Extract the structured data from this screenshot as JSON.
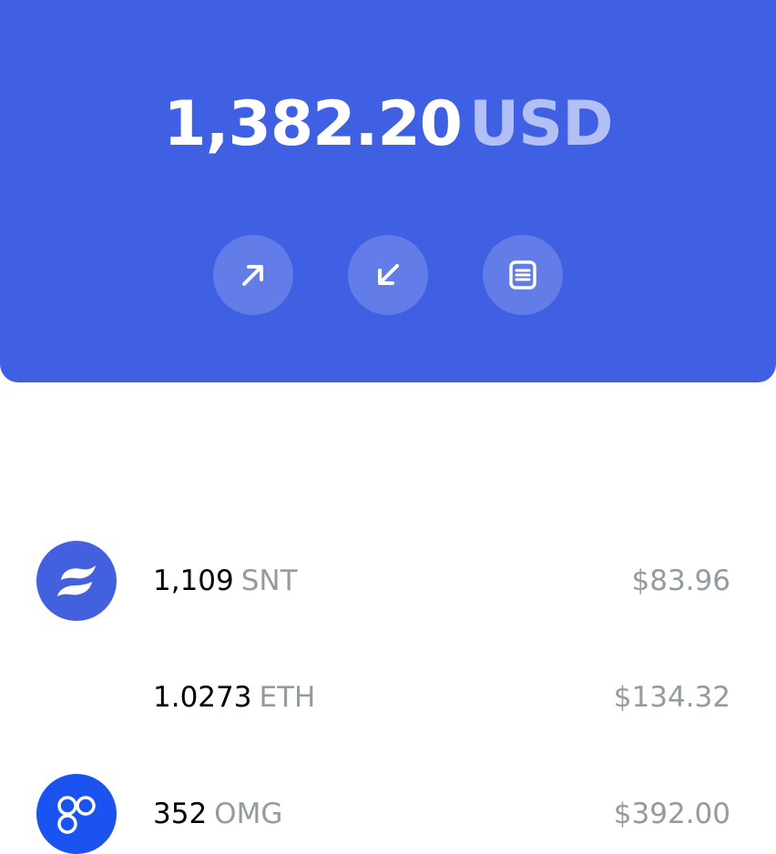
{
  "header": {
    "balance_amount": "1,382.20",
    "balance_currency": "USD",
    "background_color": "#4060e3"
  },
  "actions": [
    {
      "name": "send",
      "icon": "arrow-up-right-icon"
    },
    {
      "name": "receive",
      "icon": "arrow-down-left-icon"
    },
    {
      "name": "history",
      "icon": "document-list-icon"
    }
  ],
  "assets": [
    {
      "amount": "1,109",
      "symbol": "SNT",
      "value": "$83.96",
      "icon": "snt-logo-icon",
      "icon_color": "#4360df"
    },
    {
      "amount": "1.0273",
      "symbol": "ETH",
      "value": "$134.32",
      "icon": "",
      "icon_color": ""
    },
    {
      "amount": "352",
      "symbol": "OMG",
      "value": "$392.00",
      "icon": "omg-logo-icon",
      "icon_color": "#1a53f0"
    }
  ]
}
